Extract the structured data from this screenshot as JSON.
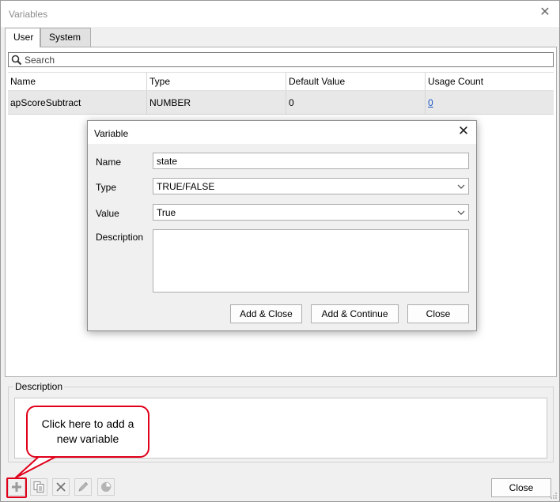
{
  "window": {
    "title": "Variables"
  },
  "tabs": [
    {
      "label": "User",
      "active": true
    },
    {
      "label": "System",
      "active": false
    }
  ],
  "search": {
    "placeholder": "Search"
  },
  "table": {
    "columns": [
      "Name",
      "Type",
      "Default Value",
      "Usage Count"
    ],
    "rows": [
      {
        "name": "apScoreSubtract",
        "type": "NUMBER",
        "default_value": "0",
        "usage_count": "0"
      }
    ]
  },
  "description_group": {
    "label": "Description"
  },
  "callout": {
    "line1": "Click here to add a",
    "line2": "new variable"
  },
  "toolbar": {
    "icons": [
      "plus-icon",
      "copy-icon",
      "delete-icon",
      "edit-icon",
      "usage-chart-icon"
    ],
    "close_label": "Close"
  },
  "dialog": {
    "title": "Variable",
    "name_label": "Name",
    "name_value": "state",
    "type_label": "Type",
    "type_value": "TRUE/FALSE",
    "value_label": "Value",
    "value_value": "True",
    "description_label": "Description",
    "buttons": {
      "add_close": "Add & Close",
      "add_continue": "Add & Continue",
      "close": "Close"
    }
  },
  "colors": {
    "highlight": "#e0001a",
    "link": "#1a55c9",
    "row_selected": "#e8e8e8"
  }
}
